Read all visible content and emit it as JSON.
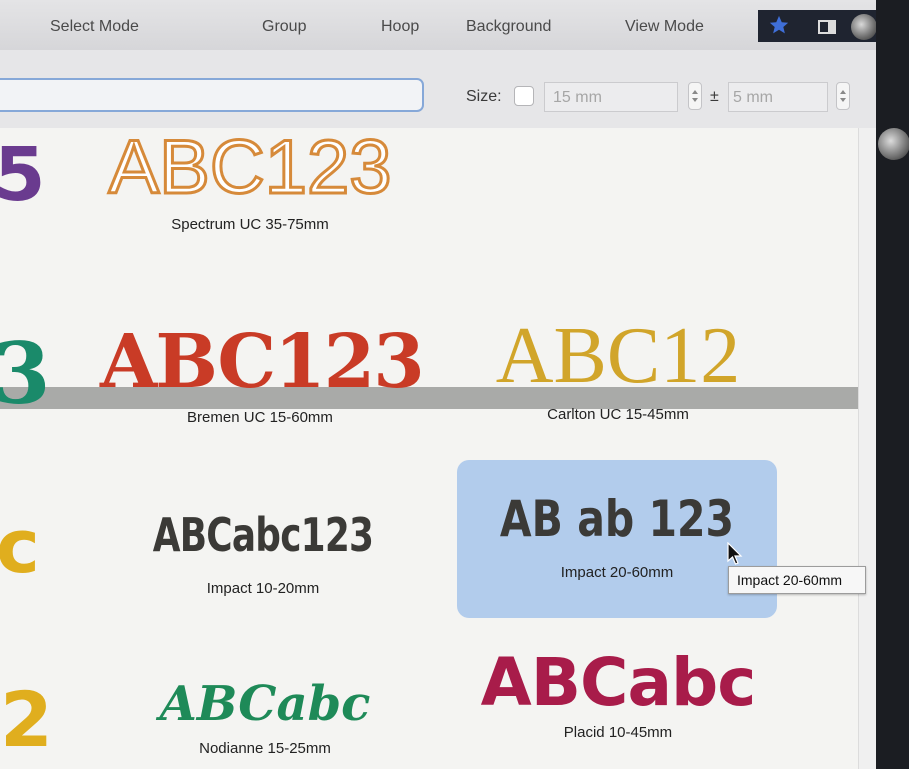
{
  "toolbar": {
    "select_mode": "Select Mode",
    "group": "Group",
    "hoop": "Hoop",
    "background": "Background",
    "view_mode": "View Mode"
  },
  "filter": {
    "size_label": "Size:",
    "size_value": "15 mm",
    "plus_minus": "±",
    "tolerance_value": "5 mm"
  },
  "fonts": [
    {
      "sample": "ABC123",
      "caption": "Spectrum UC 35-75mm",
      "color": "#d68a3a"
    },
    {
      "sample": "ABC123",
      "caption": "Bremen UC 15-60mm",
      "color": "#c93b26"
    },
    {
      "sample": "ABC12",
      "caption": "Carlton UC 15-45mm",
      "color": "#d1a52a"
    },
    {
      "sample": "ABCabc123",
      "caption": "Impact 10-20mm",
      "color": "#3b3a37"
    },
    {
      "sample": "AB ab 123",
      "caption": "Impact 20-60mm",
      "color": "#3b3a37",
      "selected": true
    },
    {
      "sample": "ABCabc",
      "caption": "Nodianne 15-25mm",
      "color": "#1e8a58"
    },
    {
      "sample": "ABCabc",
      "caption": "Placid 10-45mm",
      "color": "#a81c4a"
    }
  ],
  "partials": [
    {
      "text": "5",
      "color": "#6a3b8f"
    },
    {
      "text": "3",
      "color": "#1a8a6a"
    },
    {
      "text": "c",
      "color": "#e0ae1e"
    },
    {
      "text": "2",
      "color": "#e0ae1e"
    }
  ],
  "tooltip": "Impact 20-60mm"
}
